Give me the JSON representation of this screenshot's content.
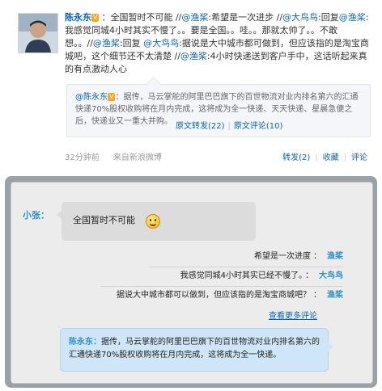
{
  "post": {
    "author": "陈永东",
    "v_badge": "V",
    "colon": "：",
    "t1": "全国暂时不可能 //",
    "at1": "@渔桨",
    "t2": ":希望是一次进步 //",
    "at2": "@大鸟鸟",
    "t3": ":回复",
    "at3": "@渔桨",
    "t4": ":我感觉同城4小时其实不慢了。。要是全国。。哇。。那就太帅了。。不敢想。。//",
    "at4": "@渔桨",
    "t5": ":回复 ",
    "at5": "@大鸟鸟",
    "t6": ":据说是大中城市都可做到，但应该指的是淘宝商城吧，这个细节还不太清楚 //",
    "at6": "@渔桨",
    "t7": ":4小时快递送到客户手中，这话听起来真的有点激动人心",
    "quote": {
      "author": "@陈永东",
      "v_badge": "V",
      "text": "：据传，马云掌舵的阿里巴巴旗下的百世物流对业内排名第六的汇通快递70%股权收购将在月内完成，这将成为全一快递、天天快递、星晨急便之后，快递业又一重大并购。",
      "repost_link": "原文转发(22)",
      "comment_link": "原文评论(10)",
      "sep": "|"
    },
    "time": "32分钟前",
    "source": "来自新浪微博",
    "actions": {
      "repost": "转发(2)",
      "favorite": "收藏",
      "comment": "评论",
      "sep": "|"
    }
  },
  "chat": {
    "speaker": "小张：",
    "main_message": "全国暂时不可能",
    "emoji_icon": "smiley-icon",
    "replies": [
      {
        "text": "希望是一次进度",
        "name": "渔桨"
      },
      {
        "text": "我感觉同城4小时其实已经不慢了。",
        "name": "大鸟鸟"
      },
      {
        "text": "据说大中城市都可以做到，但应该指的是淘宝商城吧？",
        "name": "渔桨"
      }
    ],
    "reply_colon": "：",
    "more_link": "查看更多评论",
    "bottom": {
      "name": "陈永东：",
      "text": "据传，马云掌舵的阿里巴巴旗下的百世物流对业内排名第六的汇通快递70%股权收购将在月内完成，这将成为全一快递。"
    }
  }
}
